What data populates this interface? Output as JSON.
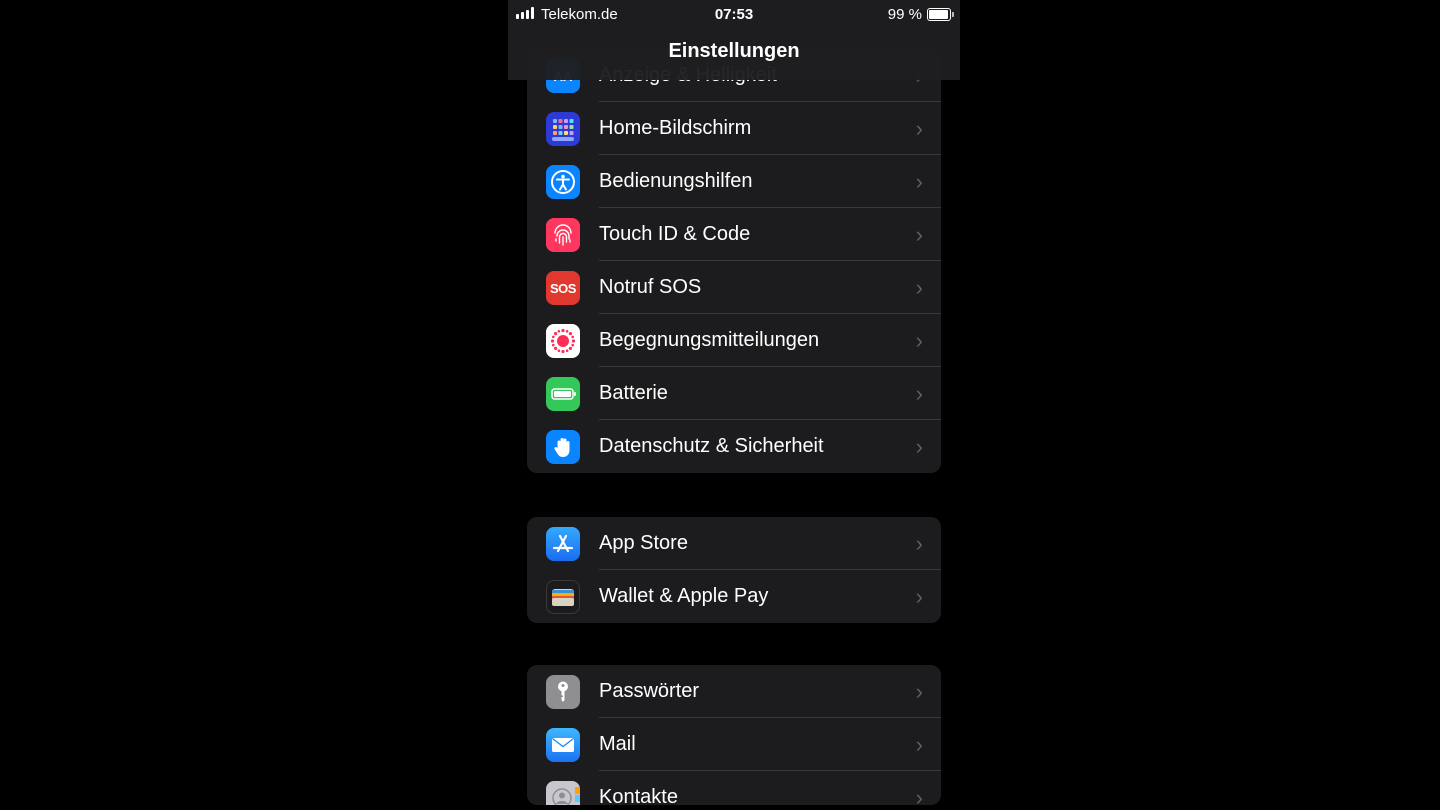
{
  "status_bar": {
    "carrier": "Telekom.de",
    "time": "07:53",
    "battery": "99 %"
  },
  "nav": {
    "title": "Einstellungen"
  },
  "groups": [
    {
      "items": [
        {
          "label": "Anzeige & Helligkeit",
          "icon": "display-brightness-icon",
          "color": "#0a84ff"
        },
        {
          "label": "Home-Bildschirm",
          "icon": "home-screen-icon",
          "color": "#2c3bd6"
        },
        {
          "label": "Bedienungshilfen",
          "icon": "accessibility-icon",
          "color": "#0a84ff"
        },
        {
          "label": "Touch ID & Code",
          "icon": "fingerprint-icon",
          "color": "#ff375f"
        },
        {
          "label": "Notruf SOS",
          "icon": "sos-icon",
          "color": "#e0382f",
          "icon_text": "SOS"
        },
        {
          "label": "Begegnungsmitteilungen",
          "icon": "exposure-notifications-icon",
          "color": "#ffffff"
        },
        {
          "label": "Batterie",
          "icon": "battery-icon",
          "color": "#34c759"
        },
        {
          "label": "Datenschutz & Sicherheit",
          "icon": "privacy-hand-icon",
          "color": "#0a84ff"
        }
      ]
    },
    {
      "items": [
        {
          "label": "App Store",
          "icon": "app-store-icon",
          "color": "#1a8cff"
        },
        {
          "label": "Wallet & Apple Pay",
          "icon": "wallet-icon",
          "color": "#1c1c1e"
        }
      ]
    },
    {
      "items": [
        {
          "label": "Passwörter",
          "icon": "key-icon",
          "color": "#8e8e93"
        },
        {
          "label": "Mail",
          "icon": "mail-icon",
          "color": "#1a8cff"
        },
        {
          "label": "Kontakte",
          "icon": "contacts-icon",
          "color": "#b8b8bc"
        }
      ]
    }
  ]
}
